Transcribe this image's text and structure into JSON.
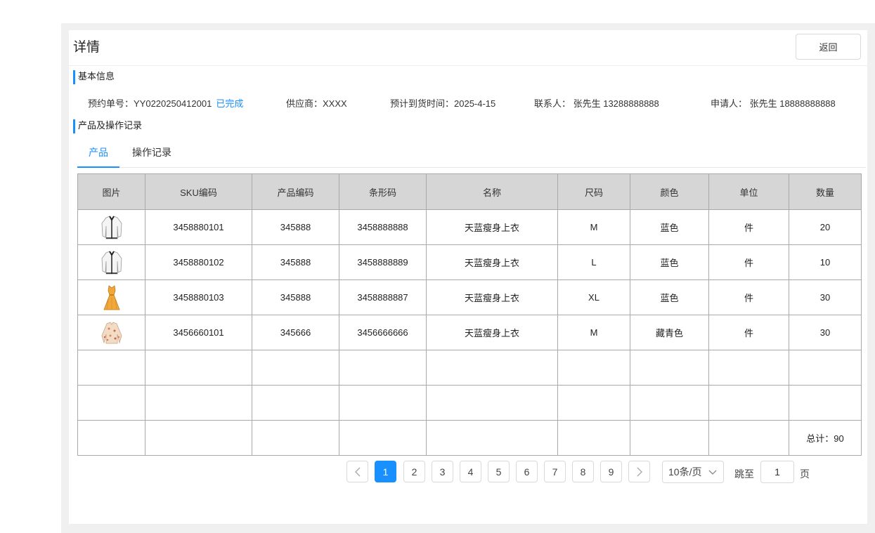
{
  "header": {
    "title": "详情",
    "back_label": "返回"
  },
  "basic_info": {
    "section_title": "基本信息",
    "order_no": "预约单号：YY0220250412001",
    "status": "已完成",
    "supplier": "供应商：XXXX",
    "eta": "预计到货时间：2025-4-15",
    "contact": "联系人： 张先生  13288888888",
    "applicant": "申请人： 张先生 18888888888"
  },
  "products_section": {
    "section_title": "产品及操作记录"
  },
  "tabs": [
    {
      "label": "产品",
      "active": true
    },
    {
      "label": "操作记录",
      "active": false
    }
  ],
  "table": {
    "columns": [
      "图片",
      "SKU编码",
      "产品编码",
      "条形码",
      "名称",
      "尺码",
      "颜色",
      "单位",
      "数量"
    ],
    "rows": [
      {
        "image": "white-cardigan-thumbnail",
        "sku": "3458880101",
        "product_code": "345888",
        "barcode": "3458888888",
        "name": "天蓝瘦身上衣",
        "size": "M",
        "color": "蓝色",
        "unit": "件",
        "qty": "20"
      },
      {
        "image": "white-cardigan-thumbnail",
        "sku": "3458880102",
        "product_code": "345888",
        "barcode": "3458888889",
        "name": "天蓝瘦身上衣",
        "size": "L",
        "color": "蓝色",
        "unit": "件",
        "qty": "10"
      },
      {
        "image": "yellow-dress-thumbnail",
        "sku": "3458880103",
        "product_code": "345888",
        "barcode": "3458888887",
        "name": "天蓝瘦身上衣",
        "size": "XL",
        "color": "蓝色",
        "unit": "件",
        "qty": "30"
      },
      {
        "image": "floral-blouse-thumbnail",
        "sku": "3456660101",
        "product_code": "345666",
        "barcode": "3456666666",
        "name": "天蓝瘦身上衣",
        "size": "M",
        "color": "藏青色",
        "unit": "件",
        "qty": "30"
      }
    ],
    "empty_rows": 2,
    "total": "总计：90"
  },
  "pagination": {
    "prev_icon": "chevron-left-icon",
    "next_icon": "chevron-right-icon",
    "pages": [
      "1",
      "2",
      "3",
      "4",
      "5",
      "6",
      "7",
      "8",
      "9"
    ],
    "current": "1",
    "page_size": "10条/页",
    "jump_label": "跳至",
    "jump_value": "1",
    "page_suffix": "页"
  },
  "colors": {
    "accent": "#1890ff",
    "header_bg": "#d6d6d6",
    "outer_bg": "#f0f0f0"
  }
}
